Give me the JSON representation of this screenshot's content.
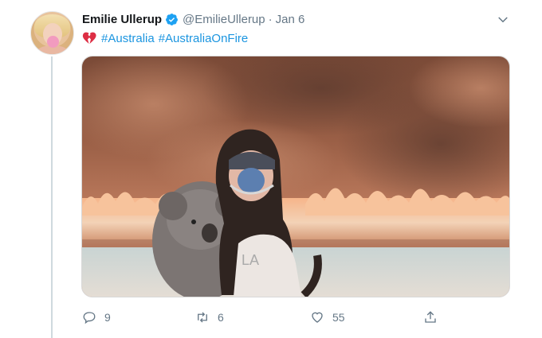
{
  "tweet": {
    "author_name": "Emilie Ullerup",
    "handle": "@EmilieUllerup",
    "separator": "·",
    "date": "Jan 6",
    "emoji": "broken-heart-icon",
    "hashtags": [
      "#Australia",
      "#AustraliaOnFire"
    ],
    "media": {
      "description_icon": "photo",
      "shirt_text": "LA"
    },
    "counts": {
      "replies": "9",
      "retweets": "6",
      "likes": "55"
    }
  },
  "colors": {
    "link": "#1b95e0",
    "muted": "#657786",
    "verified": "#1da1f2",
    "thread_line": "#cfd9de"
  }
}
